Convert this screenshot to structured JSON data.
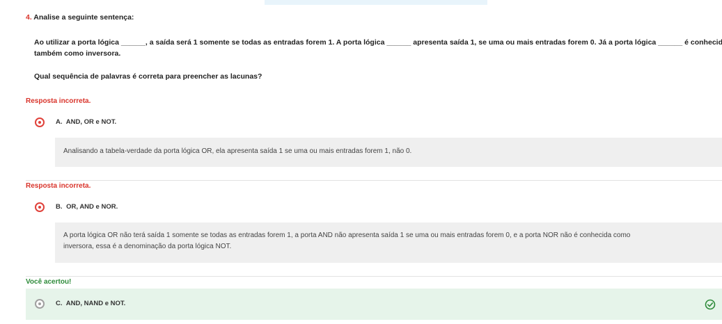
{
  "question": {
    "number": "4.",
    "header": "Analise a seguinte sentença:",
    "text_line1": "Ao utilizar a porta lógica ______, a saída será 1 somente se todas as entradas forem 1. A porta lógica ______ apresenta saída 1, se uma ou mais entradas forem 0. Já a porta lógica ______ é conhecida",
    "text_line2": "também como inversora.",
    "prompt": "Qual sequência de palavras é correta para preencher as lacunas?"
  },
  "answers": [
    {
      "status": "Resposta incorreta.",
      "letter": "A.",
      "label": "AND, OR e NOT.",
      "feedback": "Analisando a tabela-verdade da porta lógica OR, ela apresenta saída 1 se uma ou mais entradas forem 1, não 0."
    },
    {
      "status": "Resposta incorreta.",
      "letter": "B.",
      "label": "OR, AND e NOR.",
      "feedback_line1": "A porta lógica OR não terá saída 1 somente se todas as entradas forem 1, a porta AND não apresenta saída 1 se uma ou mais entradas forem 0, e a porta NOR não é conhecida como",
      "feedback_line2": "inversora, essa é a denominação da porta lógica NOT."
    },
    {
      "status": "Você acertou!",
      "letter": "C.",
      "label": "AND, NAND e NOT."
    }
  ],
  "colors": {
    "wrong": "#d9342b",
    "right": "#2e8b3a",
    "feedback_bg": "#efefef",
    "correct_bg": "#e6f4ea"
  },
  "icons": {
    "selected_radio": "radio-selected-icon",
    "correct": "check-circle-icon"
  }
}
